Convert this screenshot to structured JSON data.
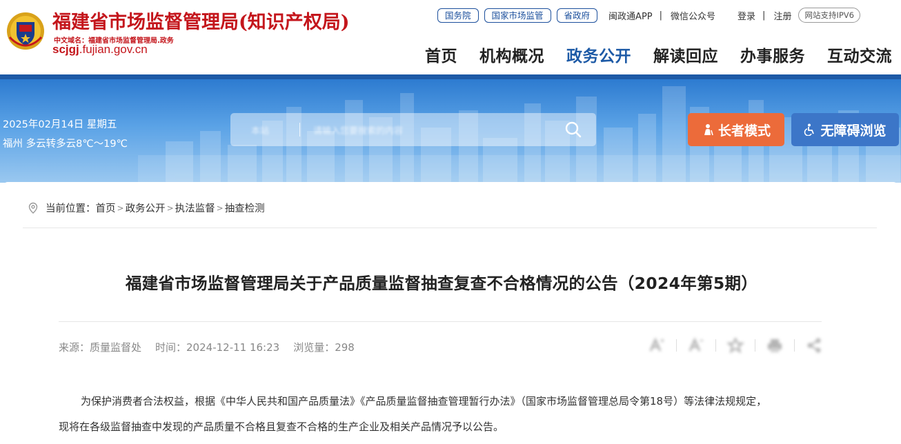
{
  "header": {
    "site_title": "福建省市场监督管理局(知识产权局)",
    "domain_cn": "中文域名：福建省市场监督管理局.政务",
    "domain_bold": "scjgj",
    "domain_rest": ".fujian.gov.cn",
    "top_links": {
      "state_council": "国务院",
      "samr": "国家市场监管",
      "provincial_gov": "省政府",
      "app": "闽政通APP",
      "wechat": "微信公众号",
      "login": "登录",
      "register": "注册",
      "ipv6": "网站支持IPV6",
      "separator": "|"
    },
    "nav": [
      "首页",
      "机构概况",
      "政务公开",
      "解读回应",
      "办事服务",
      "互动交流"
    ],
    "active_nav": "政务公开"
  },
  "banner": {
    "date": "2025年02月14日 星期五",
    "weather": "福州 多云转多云8℃～19℃",
    "search_scope": "本站",
    "search_placeholder": "请输入您要搜索的内容",
    "elder_mode": "长者模式",
    "accessible": "无障碍浏览"
  },
  "breadcrumb": {
    "label": "当前位置：",
    "items": [
      "首页",
      "政务公开",
      "执法监督",
      "抽查检测"
    ],
    "arrow": ">"
  },
  "article": {
    "title": "福建省市场监督管理局关于产品质量监督抽查复查不合格情况的公告（2024年第5期）",
    "source": "来源：质量监督处",
    "time": "时间：2024-12-11 16:23",
    "views": "浏览量：298",
    "para1": "为保护消费者合法权益，根据《中华人民共和国产品质量法》《产品质量监督抽查管理暂行办法》（国家市场监督管理总局令第18号）等法律法规规定，",
    "para2": "现将在各级监督抽查中发现的产品质量不合格且复查不合格的生产企业及相关产品情况予以公告。"
  },
  "colors": {
    "brand_red": "#c4161c",
    "brand_blue": "#1d5aa6",
    "elder_orange": "#ec6b3a",
    "access_blue": "#3c76c8"
  }
}
